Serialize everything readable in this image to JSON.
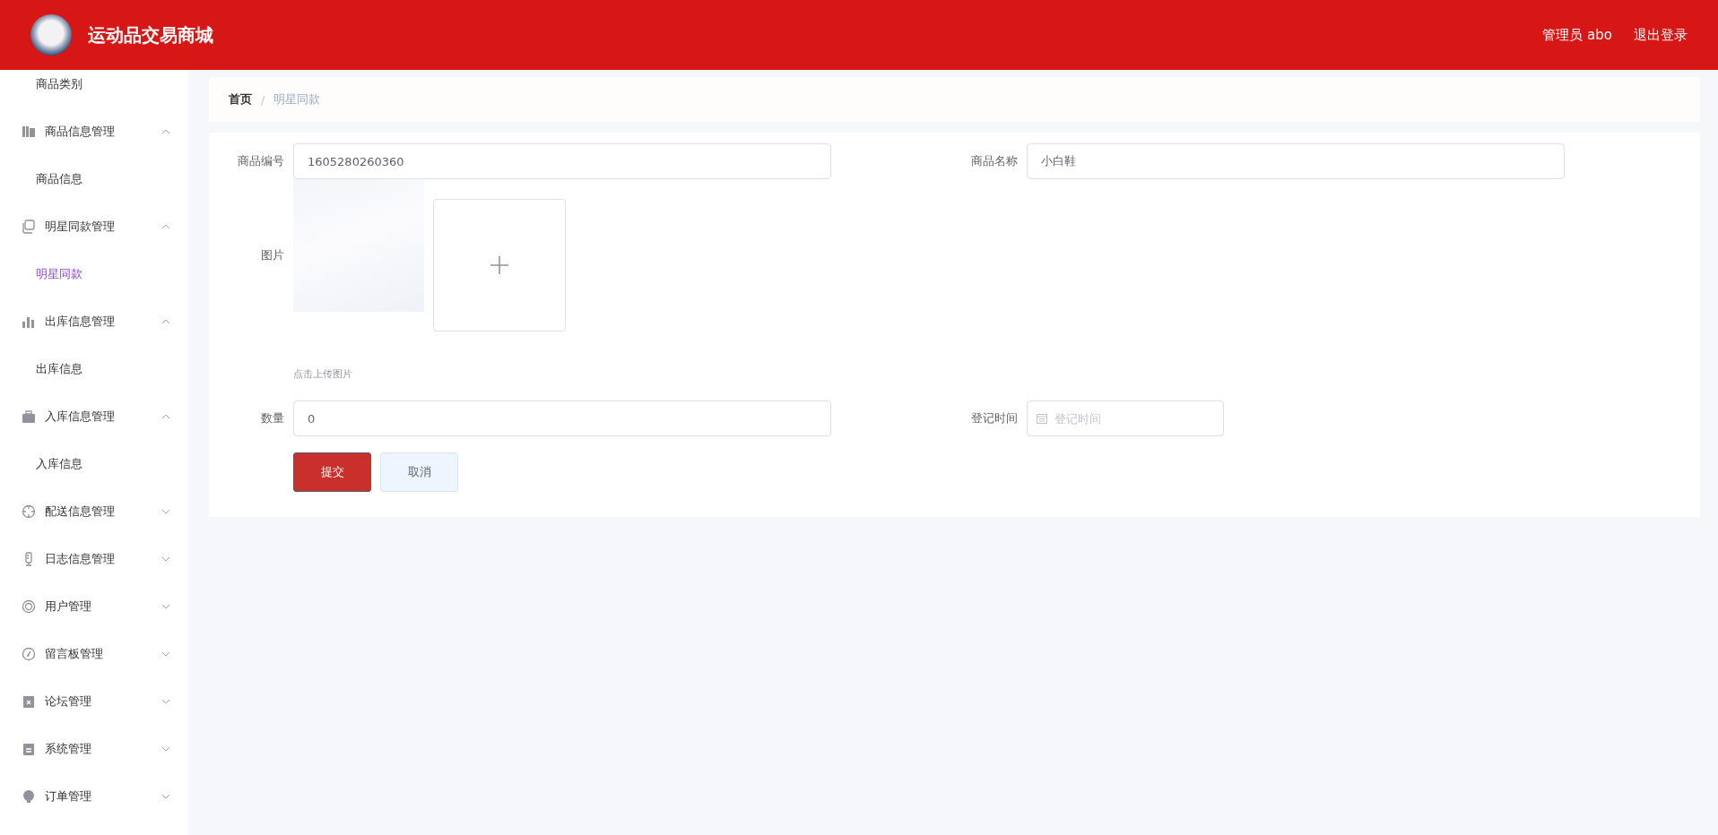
{
  "header": {
    "title": "运动品交易商城",
    "user": "管理员 abo",
    "logout": "退出登录"
  },
  "sidebar": {
    "items": [
      {
        "kind": "child",
        "label": "商品类别",
        "selected": false
      },
      {
        "kind": "group",
        "label": "商品信息管理",
        "expanded": true,
        "children": [
          {
            "label": "商品信息",
            "selected": false
          }
        ]
      },
      {
        "kind": "group",
        "label": "明星同款管理",
        "expanded": true,
        "children": [
          {
            "label": "明星同款",
            "selected": true
          }
        ]
      },
      {
        "kind": "group",
        "label": "出库信息管理",
        "expanded": true,
        "children": [
          {
            "label": "出库信息",
            "selected": false
          }
        ]
      },
      {
        "kind": "group",
        "label": "入库信息管理",
        "expanded": true,
        "children": [
          {
            "label": "入库信息",
            "selected": false
          }
        ]
      },
      {
        "kind": "group",
        "label": "配送信息管理",
        "expanded": false
      },
      {
        "kind": "group",
        "label": "日志信息管理",
        "expanded": false
      },
      {
        "kind": "group",
        "label": "用户管理",
        "expanded": false
      },
      {
        "kind": "group",
        "label": "留言板管理",
        "expanded": false
      },
      {
        "kind": "group",
        "label": "论坛管理",
        "expanded": false
      },
      {
        "kind": "group",
        "label": "系统管理",
        "expanded": false
      },
      {
        "kind": "group",
        "label": "订单管理",
        "expanded": false
      }
    ]
  },
  "breadcrumb": {
    "separator": "/",
    "items": [
      {
        "label": "首页"
      },
      {
        "label": "明星同款"
      }
    ]
  },
  "form": {
    "product_no": {
      "label": "商品编号",
      "value": "1605280260360"
    },
    "product_name": {
      "label": "商品名称",
      "value": "小白鞋"
    },
    "image": {
      "label": "图片",
      "hint": "点击上传图片"
    },
    "quantity": {
      "label": "数量",
      "value": "0"
    },
    "register_time": {
      "label": "登记时间",
      "placeholder": "登记时间"
    },
    "buttons": [
      {
        "kind": "primary",
        "label": "提交"
      },
      {
        "kind": "default",
        "label": "取消"
      }
    ]
  }
}
